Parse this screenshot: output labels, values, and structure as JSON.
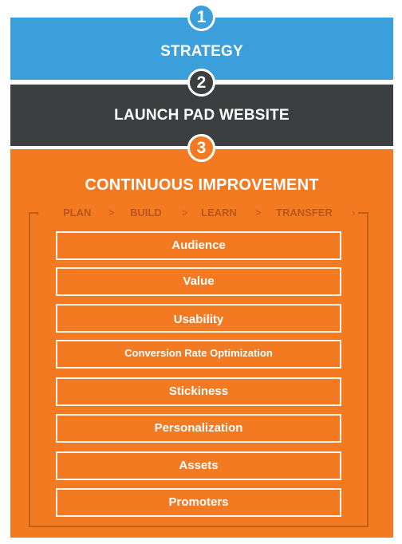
{
  "steps": [
    {
      "number": "1",
      "title": "STRATEGY",
      "color": "#3a9fdb"
    },
    {
      "number": "2",
      "title": "LAUNCH PAD WEBSITE",
      "color": "#3b3f40"
    },
    {
      "number": "3",
      "title": "CONTINUOUS IMPROVEMENT",
      "color": "#f47a22"
    }
  ],
  "cycle": {
    "stages": [
      "PLAN",
      "BUILD",
      "LEARN",
      "TRANSFER"
    ],
    "separator": ">"
  },
  "items": [
    "Audience",
    "Value",
    "Usability",
    "Conversion Rate Optimization",
    "Stickiness",
    "Personalization",
    "Assets",
    "Promoters"
  ]
}
